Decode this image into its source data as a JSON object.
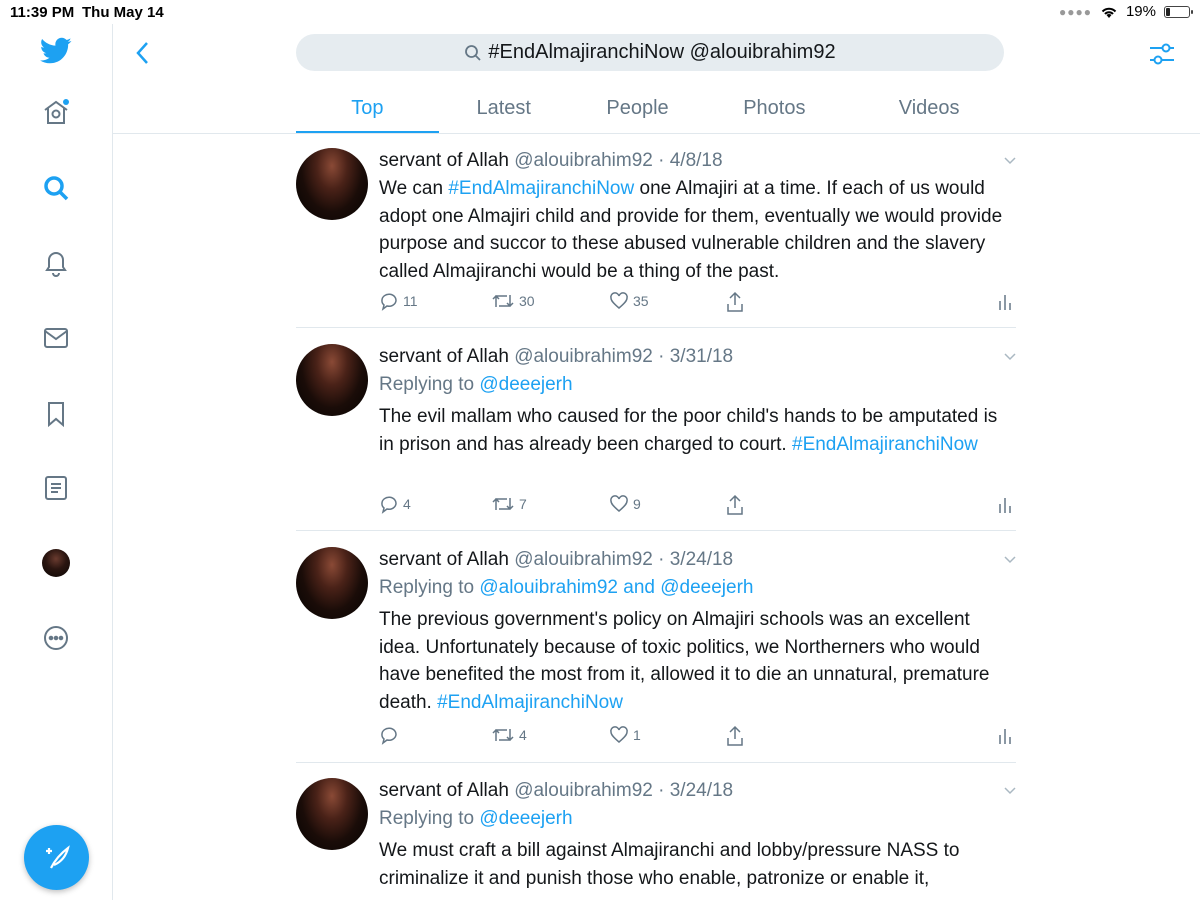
{
  "status_bar": {
    "time": "11:39 PM",
    "date": "Thu May 14",
    "battery": "19%",
    "battery_level": 0.19
  },
  "search": {
    "query": "#EndAlmajiranchiNow @alouibrahim92"
  },
  "tabs": [
    {
      "label": "Top",
      "active": true
    },
    {
      "label": "Latest",
      "active": false
    },
    {
      "label": "People",
      "active": false
    },
    {
      "label": "Photos",
      "active": false
    },
    {
      "label": "Videos",
      "active": false
    }
  ],
  "colors": {
    "accent": "#1da1f2",
    "muted": "#657786",
    "text": "#14171a",
    "divider": "#e1e8ed",
    "search_bg": "#e6ecf0"
  },
  "sidebar": {
    "icons": [
      "twitter-logo-icon",
      "home-icon",
      "search-icon",
      "notifications-icon",
      "messages-icon",
      "bookmarks-icon",
      "lists-icon",
      "profile-avatar",
      "more-icon"
    ],
    "compose_icon": "compose-feather-icon"
  },
  "tweets": [
    {
      "name": "servant of Allah",
      "handle": "@alouibrahim92",
      "date": "4/8/18",
      "reply_prefix": "",
      "reply_to": "",
      "text_parts": [
        {
          "text": "We can "
        },
        {
          "text": "#EndAlmajiranchiNow",
          "tag": true
        },
        {
          "text": " one Almajiri at a time. If each of us would adopt one Almajiri child and provide for them, eventually we would provide purpose and succor to these abused vulnerable children and the slavery called Almajiranchi would be a thing of the past."
        }
      ],
      "replies": "11",
      "retweets": "30",
      "likes": "35"
    },
    {
      "name": "servant of Allah",
      "handle": "@alouibrahim92",
      "date": "3/31/18",
      "reply_prefix": "Replying to ",
      "reply_to": "@deeejerh",
      "text_parts": [
        {
          "text": "The evil mallam who caused for the poor child's hands to be amputated is in prison and has already been charged to court. "
        },
        {
          "text": "#EndAlmajiranchiNow",
          "tag": true
        }
      ],
      "replies": "4",
      "retweets": "7",
      "likes": "9"
    },
    {
      "name": "servant of Allah",
      "handle": "@alouibrahim92",
      "date": "3/24/18",
      "reply_prefix": "Replying to ",
      "reply_to": "@alouibrahim92 and @deeejerh",
      "text_parts": [
        {
          "text": "The previous government's policy on Almajiri schools was an excellent idea. Unfortunately because of toxic politics, we Northerners who would have benefited the most from it, allowed it to die an unnatural, premature death. "
        },
        {
          "text": "#EndAlmajiranchiNow",
          "tag": true
        }
      ],
      "replies": "",
      "retweets": "4",
      "likes": "1"
    },
    {
      "name": "servant of Allah",
      "handle": "@alouibrahim92",
      "date": "3/24/18",
      "reply_prefix": "Replying to ",
      "reply_to": "@deeejerh",
      "text_parts": [
        {
          "text": "We must craft a bill against Almajiranchi and lobby/pressure NASS to criminalize it and punish those who enable, patronize or enable it,"
        }
      ],
      "replies": null,
      "retweets": null,
      "likes": null
    }
  ]
}
